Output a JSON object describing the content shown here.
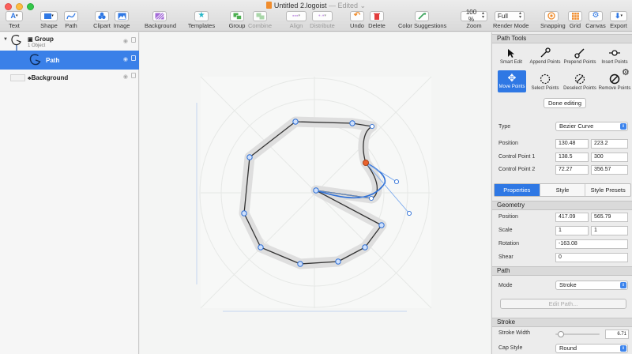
{
  "window": {
    "title": "Untitled 2.logoist",
    "status": "— Edited"
  },
  "toolbar": {
    "text": "Text",
    "shape": "Shape",
    "path": "Path",
    "clipart": "Clipart",
    "image": "Image",
    "background": "Background",
    "templates": "Templates",
    "group": "Group",
    "combine": "Combine",
    "align": "Align",
    "distribute": "Distribute",
    "undo": "Undo",
    "delete": "Delete",
    "color_suggestions": "Color Suggestions",
    "zoom_label": "Zoom",
    "zoom_value": "100 %",
    "render_mode_label": "Render Mode",
    "render_mode_value": "Full",
    "snapping": "Snapping",
    "grid": "Grid",
    "canvas": "Canvas",
    "export": "Export"
  },
  "layers": {
    "group_name": "Group",
    "group_sub": "1 Object",
    "path_name": "Path",
    "background_name": "Background"
  },
  "inspector": {
    "path_tools_title": "Path Tools",
    "tools_row1": [
      "Smart Edit",
      "Append Points",
      "Prepend Points",
      "Insert Points"
    ],
    "tools_row2": [
      "Move Points",
      "Select Points",
      "Deselect Points",
      "Remove Points"
    ],
    "done_editing": "Done editing",
    "type_label": "Type",
    "type_value": "Bezier Curve",
    "position_label": "Position",
    "position_x": "130.48",
    "position_y": "223.2",
    "cp1_label": "Control Point 1",
    "cp1_x": "138.5",
    "cp1_y": "300",
    "cp2_label": "Control Point 2",
    "cp2_x": "72.27",
    "cp2_y": "356.57",
    "tabs": [
      "Properties",
      "Style",
      "Style Presets"
    ],
    "geometry_title": "Geometry",
    "geo_position_label": "Position",
    "geo_position_x": "417.09",
    "geo_position_y": "565.79",
    "scale_label": "Scale",
    "scale_x": "1",
    "scale_y": "1",
    "rotation_label": "Rotation",
    "rotation_value": "-163.08",
    "shear_label": "Shear",
    "shear_value": "0",
    "path_title": "Path",
    "mode_label": "Mode",
    "mode_value": "Stroke",
    "edit_path": "Edit Path...",
    "stroke_title": "Stroke",
    "stroke_width_label": "Stroke Width",
    "stroke_width_value": "6.71",
    "stroke_width_fraction": 0.13,
    "cap_style_label": "Cap Style",
    "cap_style_value": "Round"
  },
  "colors": {
    "selection_blue": "#3a80e8",
    "handle_blue": "#2d6fd6",
    "anchor_selected": "#e8622c"
  }
}
